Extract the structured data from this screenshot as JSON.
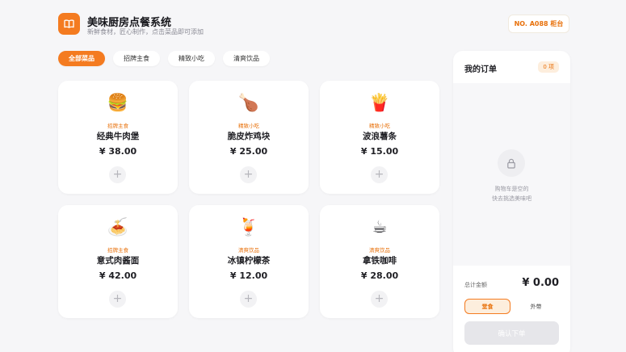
{
  "header": {
    "title": "美味厨房点餐系统",
    "subtitle": "新鲜食材，匠心制作，点击菜品即可添加",
    "table_label": "NO. A088 柜台"
  },
  "tabs": [
    {
      "label": "全部菜品",
      "active": true
    },
    {
      "label": "招牌主食",
      "active": false
    },
    {
      "label": "精致小吃",
      "active": false
    },
    {
      "label": "清爽饮品",
      "active": false
    }
  ],
  "menu": [
    {
      "emoji": "🍔",
      "category": "招牌主食",
      "name": "经典牛肉堡",
      "price": "¥ 38.00"
    },
    {
      "emoji": "🍗",
      "category": "精致小吃",
      "name": "脆皮炸鸡块",
      "price": "¥ 25.00"
    },
    {
      "emoji": "🍟",
      "category": "精致小吃",
      "name": "波浪薯条",
      "price": "¥ 15.00"
    },
    {
      "emoji": "🍝",
      "category": "招牌主食",
      "name": "意式肉酱面",
      "price": "¥ 42.00"
    },
    {
      "emoji": "🍹",
      "category": "清爽饮品",
      "name": "冰镇柠檬茶",
      "price": "¥ 12.00"
    },
    {
      "emoji": "☕",
      "category": "清爽饮品",
      "name": "拿铁咖啡",
      "price": "¥ 28.00"
    }
  ],
  "add_symbol": "+",
  "order": {
    "title": "我的订单",
    "count_badge": "0 项",
    "empty_line1": "购物车是空的",
    "empty_line2": "快去挑选美味吧",
    "total_label": "总计金额",
    "total_value": "¥ 0.00",
    "modes": [
      {
        "label": "堂食",
        "active": true
      },
      {
        "label": "外带",
        "active": false
      }
    ],
    "submit_label": "确认下单"
  },
  "colors": {
    "accent": "#f47b20",
    "accent_text": "#e8700a",
    "background": "#f6f6f8"
  }
}
